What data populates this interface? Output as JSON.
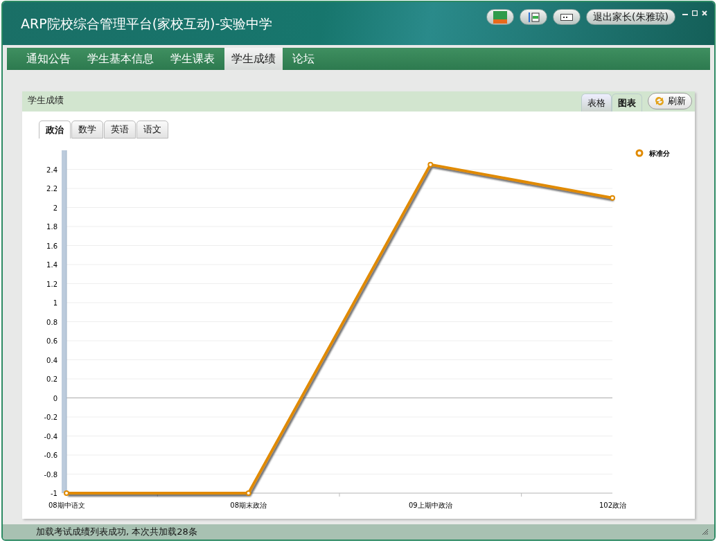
{
  "window": {
    "title": "ARP院校综合管理平台(家校互动)-实验中学",
    "logout_button": "退出家长(朱雅琼)"
  },
  "nav_tabs": [
    {
      "label": "通知公告",
      "selected": false
    },
    {
      "label": "学生基本信息",
      "selected": false
    },
    {
      "label": "学生课表",
      "selected": false
    },
    {
      "label": "学生成绩",
      "selected": true
    },
    {
      "label": "论坛",
      "selected": false
    }
  ],
  "panel": {
    "title": "学生成绩",
    "view_tabs": [
      {
        "label": "表格",
        "selected": false
      },
      {
        "label": "图表",
        "selected": true
      }
    ],
    "refresh_button": "刷新",
    "subject_tabs": [
      {
        "label": "政治",
        "selected": true
      },
      {
        "label": "数学",
        "selected": false
      },
      {
        "label": "英语",
        "selected": false
      },
      {
        "label": "语文",
        "selected": false
      }
    ],
    "chart_data": {
      "type": "line",
      "categories": [
        "08期中语文",
        "08期末政治",
        "09上期中政治",
        "102政治"
      ],
      "series": [
        {
          "name": "标准分",
          "color": "#e08a00",
          "marker": true,
          "values": [
            -1,
            -1,
            2.45,
            2.1
          ]
        }
      ],
      "ylim": [
        -1,
        2.6
      ],
      "grid": true,
      "yticks": [
        -1,
        -0.8,
        -0.6,
        -0.4,
        -0.2,
        0,
        0.2,
        0.4,
        0.6,
        0.8,
        1,
        1.2,
        1.4,
        1.6,
        1.8,
        2,
        2.2,
        2.4
      ]
    }
  },
  "status_bar": "加载考试成绩列表成功, 本次共加载28条"
}
